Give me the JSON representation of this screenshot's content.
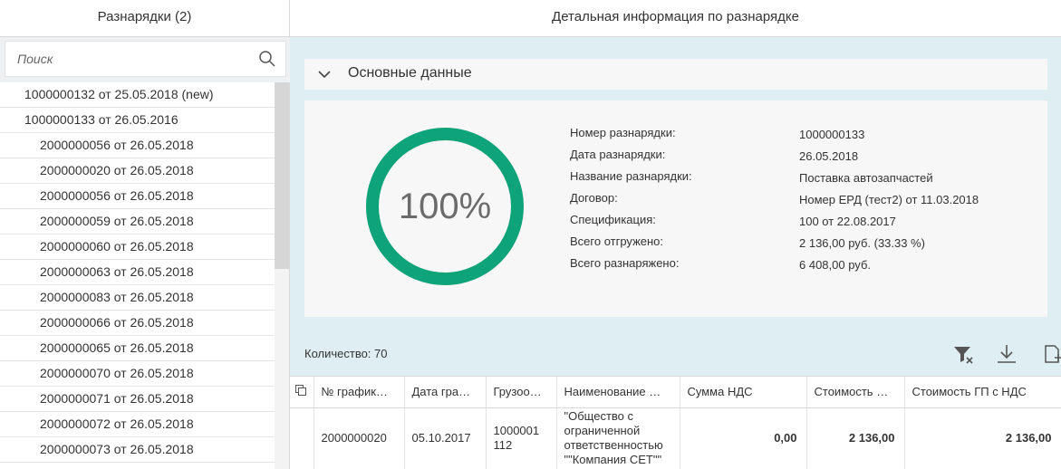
{
  "left_pane": {
    "title": "Разнарядки (2)",
    "search": {
      "placeholder": "Поиск",
      "value": ""
    },
    "items": [
      {
        "label": "1000000132 от 25.05.2018 (new)",
        "level": 0
      },
      {
        "label": "1000000133 от 26.05.2016",
        "level": 0
      },
      {
        "label": "2000000056 от 26.05.2018",
        "level": 1
      },
      {
        "label": "2000000020 от 26.05.2018",
        "level": 1
      },
      {
        "label": "2000000056 от 26.05.2018",
        "level": 1
      },
      {
        "label": "2000000059 от 26.05.2018",
        "level": 1
      },
      {
        "label": "2000000060 от 26.05.2018",
        "level": 1
      },
      {
        "label": "2000000063 от 26.05.2018",
        "level": 1
      },
      {
        "label": "2000000083 от 26.05.2018",
        "level": 1
      },
      {
        "label": "2000000066 от 26.05.2018",
        "level": 1
      },
      {
        "label": "2000000065 от 26.05.2018",
        "level": 1
      },
      {
        "label": "2000000070 от 26.05.2018",
        "level": 1
      },
      {
        "label": "2000000071 от 26.05.2018",
        "level": 1
      },
      {
        "label": "2000000072 от 26.05.2018",
        "level": 1
      },
      {
        "label": "2000000073 от 26.05.2018",
        "level": 1
      }
    ]
  },
  "right_pane": {
    "title": "Детальная информация по разнарядке",
    "section_title": "Основные данные",
    "progress": {
      "label": "100%",
      "value": 1.0,
      "color": "#0fa37a"
    },
    "details": [
      {
        "label": "Номер разнарядки:",
        "value": "1000000133"
      },
      {
        "label": "Дата разнарядки:",
        "value": "26.05.2018"
      },
      {
        "label": "Название разнарядки:",
        "value": "Поставка автозапчастей"
      },
      {
        "label": "Договор:",
        "value": "Номер ЕРД (тест2) от 11.03.2018"
      },
      {
        "label": "Спецификация:",
        "value": "100 от 22.08.2017"
      },
      {
        "label": "Всего отгружено:",
        "value": "2 136,00 руб. (33.33 %)"
      },
      {
        "label": "Всего разнаряжено:",
        "value": "6 408,00 руб."
      }
    ],
    "count_label": "Количество: 70",
    "toolbar": {
      "clear_filter_icon": "filter-clear-icon",
      "download_icon": "download-icon",
      "export_icon": "export-icon"
    }
  },
  "table": {
    "headers": [
      "№ графика отгрузки",
      "Дата графика",
      "Грузоотправитель",
      "Наименование грузоотправителя",
      "Сумма НДС",
      "Стоимость ГП",
      "Стоимость ГП с НДС"
    ],
    "header_display": [
      "№ график…",
      "Дата гра…",
      "Грузоо…",
      "Наименование …",
      "Сумма НДС",
      "Стоимость …",
      "Стоимость ГП с НДС"
    ],
    "rows": [
      {
        "schedule_no": "2000000020",
        "date": "05.10.2017",
        "shipper": "1000001 112",
        "shipper_name": "\"Общество с ограниченной ответственностью \"\"Компания СЕТ\"\"",
        "vat": "0,00",
        "cost": "2 136,00",
        "cost_vat": "2 136,00"
      }
    ]
  }
}
